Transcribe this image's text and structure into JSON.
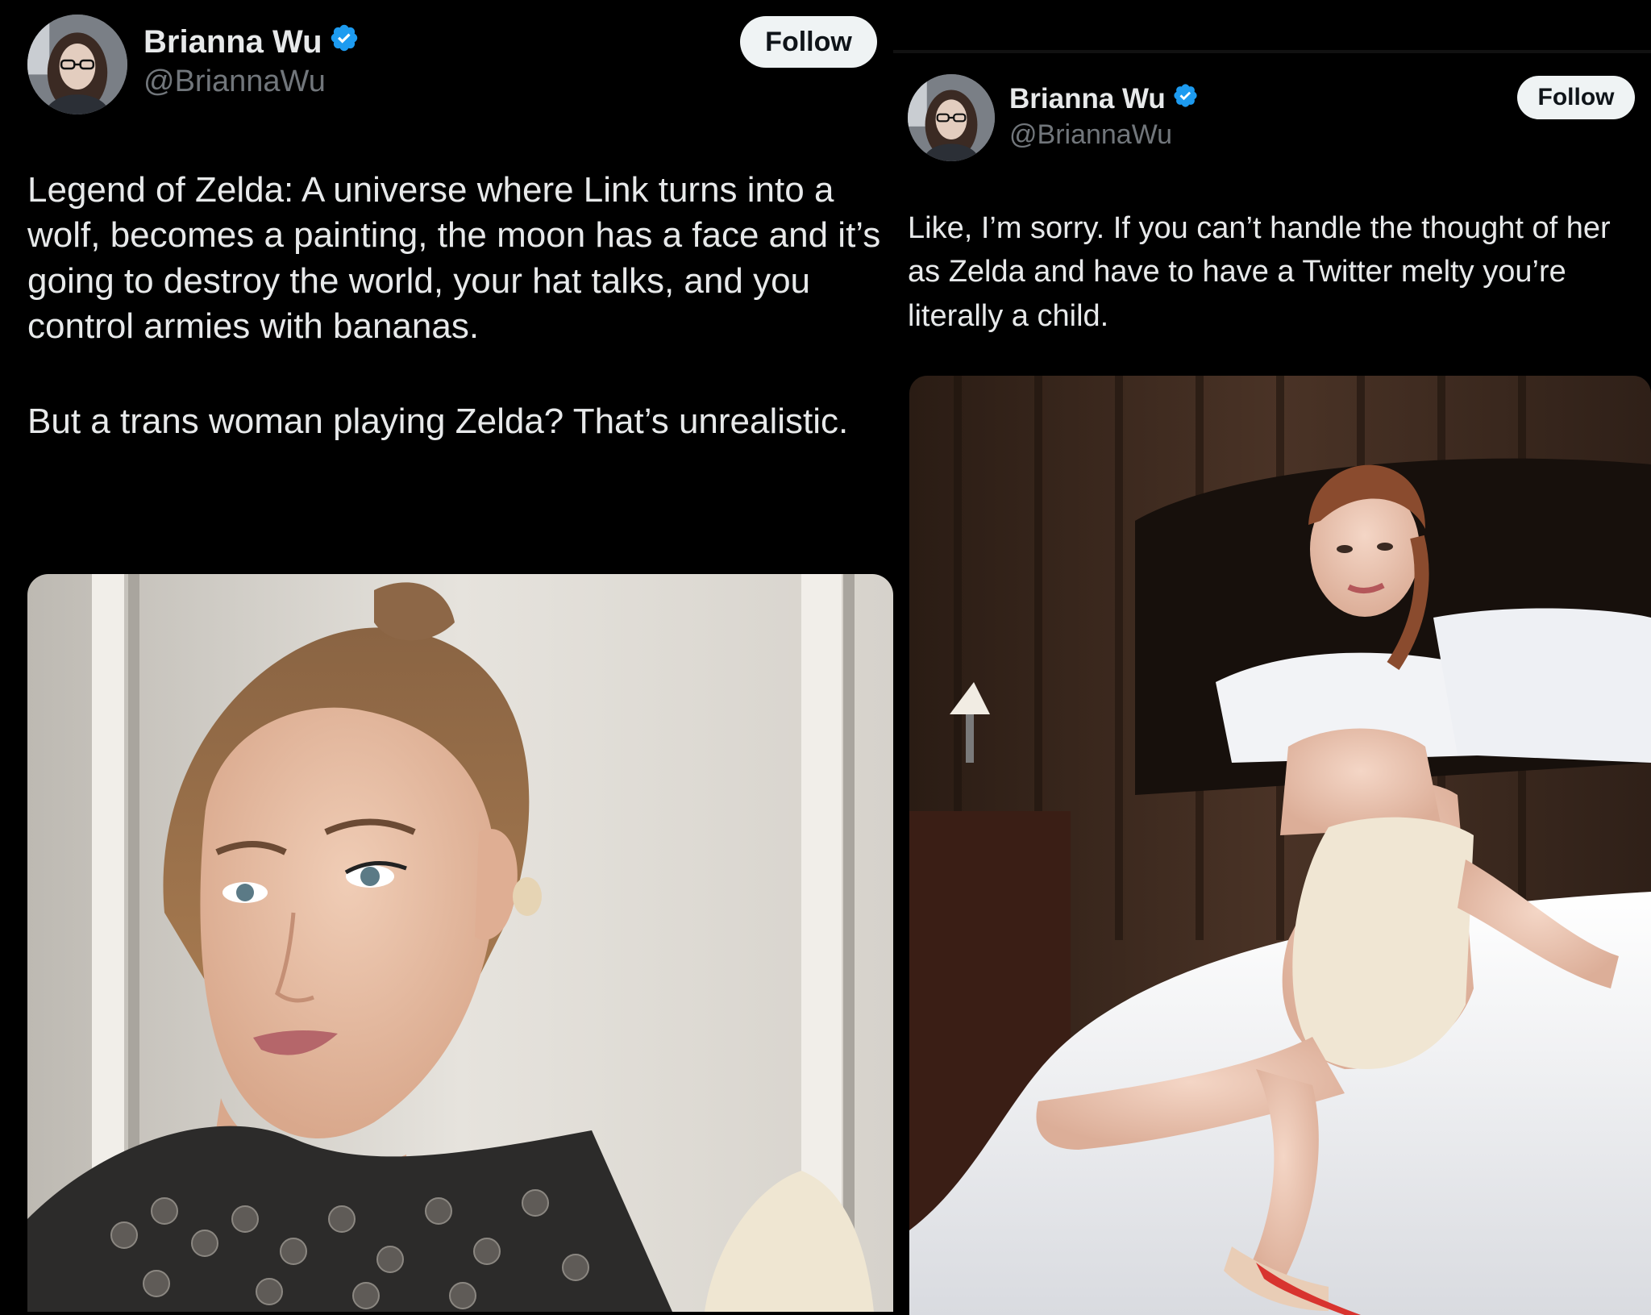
{
  "left_tweet": {
    "author_name": "Brianna Wu",
    "author_handle": "@BriannaWu",
    "follow_label": "Follow",
    "paragraphs": [
      "Legend of Zelda: A universe where Link turns into a wolf, becomes a painting, the moon has a face and it’s going to destroy the world, your hat talks, and you control armies with bananas.",
      "But a trans woman playing Zelda? That’s unrealistic."
    ]
  },
  "right_tweet": {
    "author_name": "Brianna Wu",
    "author_handle": "@BriannaWu",
    "follow_label": "Follow",
    "paragraphs": [
      "Like, I’m sorry. If you can’t handle the thought of her as Zelda and have to have a Twitter melty you’re literally a child."
    ]
  },
  "colors": {
    "background": "#000000",
    "text": "#e7e9ea",
    "handle": "#71767b",
    "verified_badge": "#1d9bf0",
    "follow_button_bg": "#eff3f4",
    "follow_button_text": "#0f1419"
  }
}
